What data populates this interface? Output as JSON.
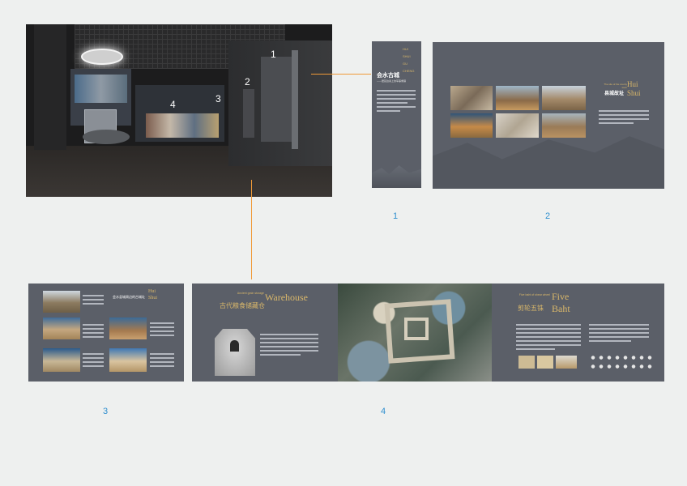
{
  "gallery": {
    "markers": [
      "1",
      "2",
      "3",
      "4"
    ]
  },
  "panel1": {
    "vertical_words": [
      "HUI",
      "SHUI",
      "GU",
      "CHENG"
    ],
    "title_cn": "会水古城",
    "subtitle_cn": "——居延边塞上的军事重镇"
  },
  "panel2": {
    "side_title_en": "Hui Shui",
    "side_title_cn": "县城故址",
    "side_small_en": "The site of the county town"
  },
  "panel3": {
    "title_cn": "会水县城周边的古城址",
    "title_en": "Hui Shui"
  },
  "panel4": {
    "left_small_en": "Ancient grain storage",
    "left_title_en": "Warehouse",
    "left_title_cn": "古代粮食储藏仓",
    "right_small_en": "Five baht of shear wheel",
    "right_title_en": "Five",
    "right_title_en2": "Baht",
    "right_title_cn": "剪轮五铢"
  },
  "captions": [
    "1",
    "2",
    "3",
    "4"
  ],
  "colors": {
    "panel": "#5b5f68",
    "accent_gold": "#d9b76a",
    "connector": "#f09a38",
    "caption": "#2f8fcf"
  }
}
